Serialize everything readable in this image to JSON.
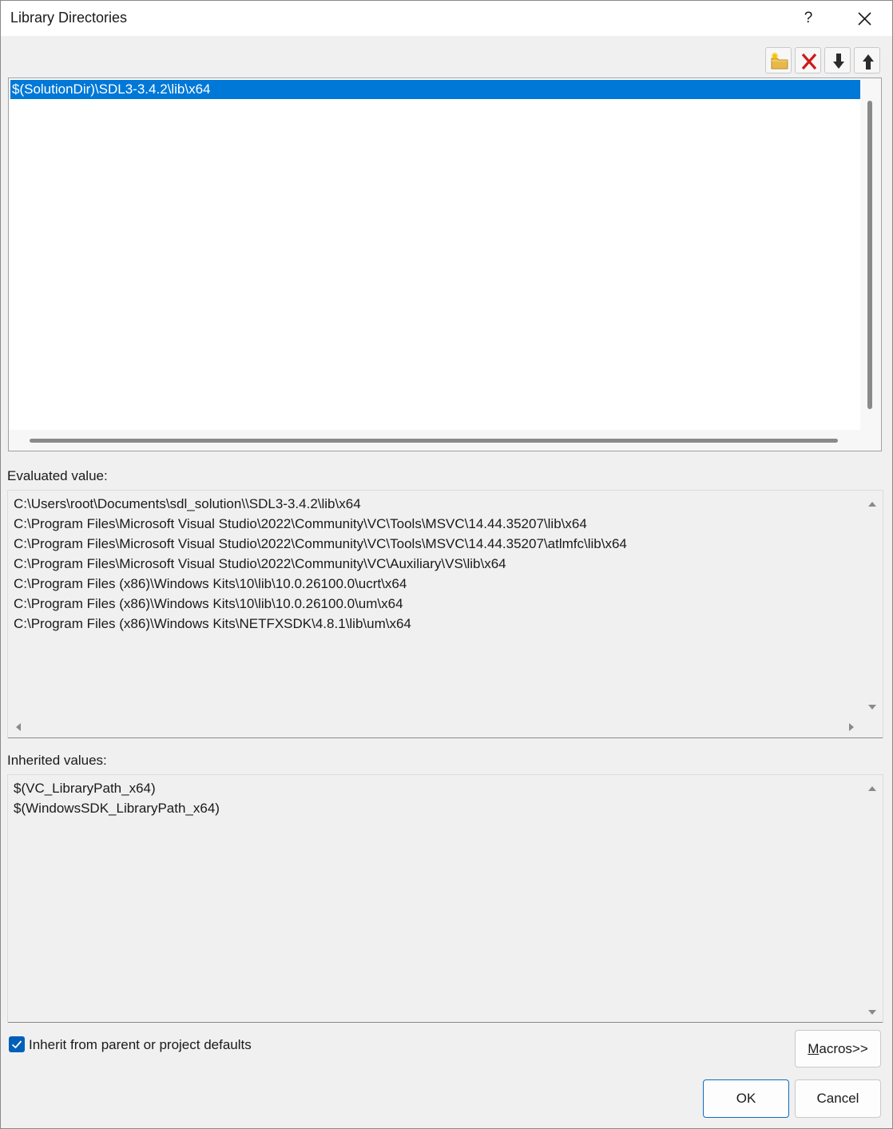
{
  "window": {
    "title": "Library Directories",
    "help_label": "?"
  },
  "toolbar": {
    "icons": [
      "new-folder-icon",
      "delete-icon",
      "move-down-icon",
      "move-up-icon"
    ]
  },
  "edit_list": {
    "items": [
      "$(SolutionDir)\\SDL3-3.4.2\\lib\\x64"
    ],
    "selected_index": 0
  },
  "evaluated": {
    "label": "Evaluated value:",
    "lines": [
      "C:\\Users\\root\\Documents\\sdl_solution\\\\SDL3-3.4.2\\lib\\x64",
      "C:\\Program Files\\Microsoft Visual Studio\\2022\\Community\\VC\\Tools\\MSVC\\14.44.35207\\lib\\x64",
      "C:\\Program Files\\Microsoft Visual Studio\\2022\\Community\\VC\\Tools\\MSVC\\14.44.35207\\atlmfc\\lib\\x64",
      "C:\\Program Files\\Microsoft Visual Studio\\2022\\Community\\VC\\Auxiliary\\VS\\lib\\x64",
      "C:\\Program Files (x86)\\Windows Kits\\10\\lib\\10.0.26100.0\\ucrt\\x64",
      "C:\\Program Files (x86)\\Windows Kits\\10\\lib\\10.0.26100.0\\um\\x64",
      "C:\\Program Files (x86)\\Windows Kits\\NETFXSDK\\4.8.1\\lib\\um\\x64"
    ]
  },
  "inherited": {
    "label": "Inherited values:",
    "lines": [
      "$(VC_LibraryPath_x64)",
      "$(WindowsSDK_LibraryPath_x64)"
    ]
  },
  "inherit_checkbox": {
    "label": "Inherit from parent or project defaults",
    "checked": true
  },
  "buttons": {
    "macros_pre": "M",
    "macros_rest": "acros>>",
    "ok": "OK",
    "cancel": "Cancel"
  },
  "colors": {
    "selection": "#0078d7",
    "checkbox": "#005fb8",
    "delete_red": "#d01818",
    "folder": "#e8b94a"
  }
}
